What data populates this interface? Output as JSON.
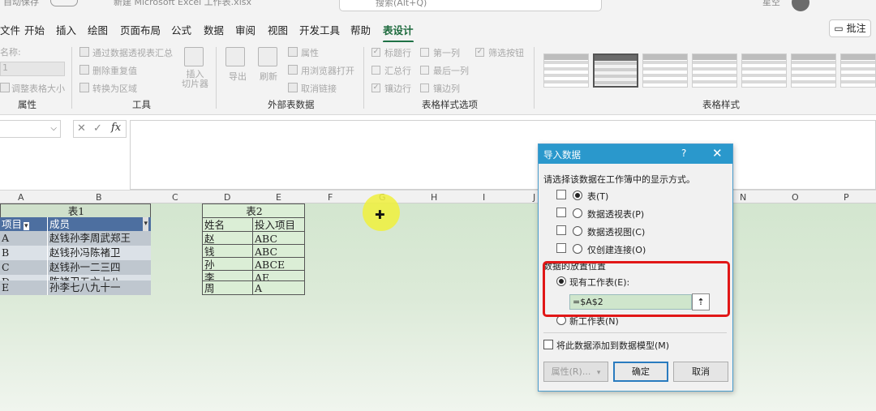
{
  "titlebar": {
    "autosave_label": "自动保存",
    "filename": "新建 Microsoft Excel 工作表.xlsx",
    "search_placeholder": "搜索(Alt+Q)",
    "user_name": "星空"
  },
  "tabs": [
    {
      "label": "文件"
    },
    {
      "label": "开始"
    },
    {
      "label": "插入"
    },
    {
      "label": "绘图"
    },
    {
      "label": "页面布局"
    },
    {
      "label": "公式"
    },
    {
      "label": "数据"
    },
    {
      "label": "审阅"
    },
    {
      "label": "视图"
    },
    {
      "label": "开发工具"
    },
    {
      "label": "帮助"
    },
    {
      "label": "表设计"
    }
  ],
  "comment_button": "批注",
  "ribbon": {
    "properties": {
      "name_label": "名称:",
      "name_value": "1",
      "resize_label": "调整表格大小",
      "group": "属性"
    },
    "tools": {
      "pivot": "通过数据透视表汇总",
      "dedup": "删除重复值",
      "convert": "转换为区域",
      "slicer": "插入\n切片器",
      "group": "工具"
    },
    "external": {
      "export": "导出",
      "refresh": "刷新",
      "properties": "属性",
      "open_browser": "用浏览器打开",
      "unlink": "取消链接",
      "group": "外部表数据"
    },
    "style_options": {
      "header_row": "标题行",
      "first_column": "第一列",
      "filter_button": "筛选按钮",
      "total_row": "汇总行",
      "last_column": "最后一列",
      "banded_rows": "镶边行",
      "banded_columns": "镶边列",
      "group": "表格样式选项"
    },
    "table_styles": {
      "group": "表格样式"
    }
  },
  "formula_bar": {
    "fx": "fx",
    "cancel": "✕",
    "enter": "✓"
  },
  "columns": [
    "A",
    "B",
    "C",
    "D",
    "E",
    "F",
    "G",
    "H",
    "I",
    "J",
    "N",
    "O",
    "P"
  ],
  "table1": {
    "title": "表1",
    "header_col1": "项目",
    "header_col2": "成员",
    "rows": [
      {
        "a": "A",
        "b": "赵钱孙李周武郑王"
      },
      {
        "a": "B",
        "b": "赵钱孙冯陈褚卫"
      },
      {
        "a": "C",
        "b": "赵钱孙一二三四"
      },
      {
        "a": "D",
        "b": "陈褚卫五六七八"
      },
      {
        "a": "E",
        "b": "孙李七八九十一"
      }
    ]
  },
  "table2": {
    "title": "表2",
    "header_col1": "姓名",
    "header_col2": "投入项目",
    "rows": [
      {
        "d": "赵",
        "e": "ABC"
      },
      {
        "d": "钱",
        "e": "ABC"
      },
      {
        "d": "孙",
        "e": "ABCE"
      },
      {
        "d": "李",
        "e": "AE"
      },
      {
        "d": "周",
        "e": "A"
      }
    ]
  },
  "dialog": {
    "title": "导入数据",
    "help": "?",
    "close": "✕",
    "prompt": "请选择该数据在工作簿中的显示方式。",
    "options": [
      {
        "label": "表(T)",
        "selected": true
      },
      {
        "label": "数据透视表(P)",
        "selected": false
      },
      {
        "label": "数据透视图(C)",
        "selected": false
      },
      {
        "label": "仅创建连接(O)",
        "selected": false
      }
    ],
    "placement_title": "数据的放置位置",
    "existing_sheet": "现有工作表(E):",
    "address": "=$A$2",
    "new_sheet": "新工作表(N)",
    "add_to_model": "将此数据添加到数据模型(M)",
    "properties_btn": "属性(R)...",
    "ok_btn": "确定",
    "cancel_btn": "取消"
  }
}
